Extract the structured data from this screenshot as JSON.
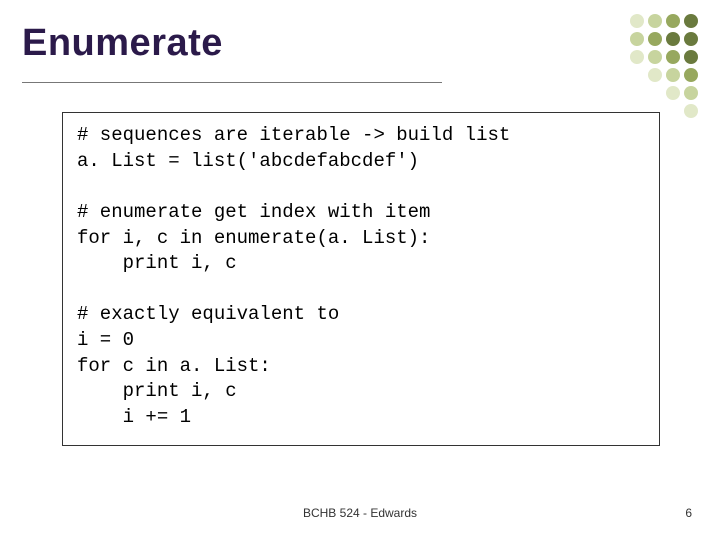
{
  "title": "Enumerate",
  "code": "# sequences are iterable -> build list\na. List = list('abcdefabcdef')\n\n# enumerate get index with item\nfor i, c in enumerate(a. List):\n    print i, c\n\n# exactly equivalent to\ni = 0\nfor c in a. List:\n    print i, c\n    i += 1",
  "footer_center": "BCHB 524 - Edwards",
  "page_number": "6",
  "dot_colors": {
    "dark": "#6a7a3e",
    "mid": "#97a85e",
    "light": "#c7d49e",
    "pale": "#e1e8c8"
  }
}
